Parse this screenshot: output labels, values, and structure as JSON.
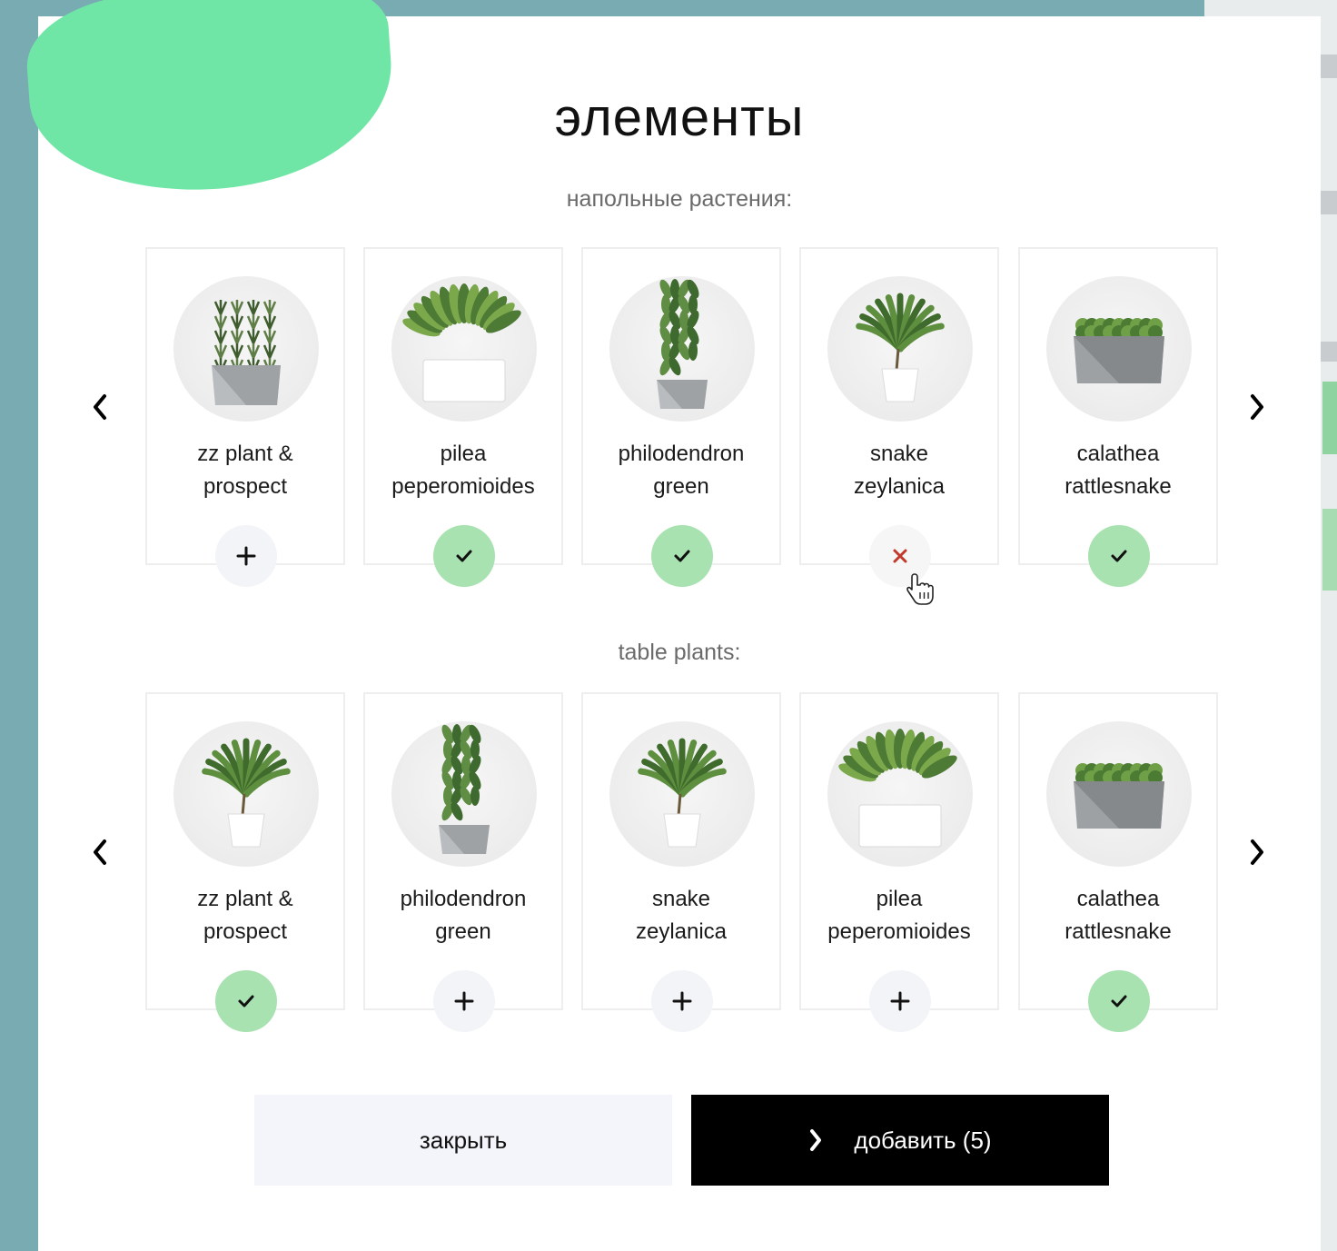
{
  "modal": {
    "title": "элементы",
    "close_label": "закрыть",
    "add_label": "добавить (5)"
  },
  "floor_section": {
    "label": "напольные растения:",
    "items": [
      {
        "line1": "zz plant &",
        "line2": "prospect",
        "state": "add",
        "plant": "grass-column"
      },
      {
        "line1": "pilea",
        "line2": "peperomioides",
        "state": "added",
        "plant": "broad-leaf"
      },
      {
        "line1": "philodendron",
        "line2": "green",
        "state": "added",
        "plant": "tall-column"
      },
      {
        "line1": "snake",
        "line2": "zeylanica",
        "state": "remove",
        "plant": "palm"
      },
      {
        "line1": "calathea",
        "line2": "rattlesnake",
        "state": "added",
        "plant": "hedge"
      }
    ]
  },
  "table_section": {
    "label": "table plants:",
    "items": [
      {
        "line1": "zz plant &",
        "line2": "prospect",
        "state": "added",
        "plant": "palm"
      },
      {
        "line1": "philodendron",
        "line2": "green",
        "state": "add",
        "plant": "tall-column"
      },
      {
        "line1": "snake",
        "line2": "zeylanica",
        "state": "add",
        "plant": "palm"
      },
      {
        "line1": "pilea",
        "line2": "peperomioides",
        "state": "add",
        "plant": "broad-leaf"
      },
      {
        "line1": "calathea",
        "line2": "rattlesnake",
        "state": "added",
        "plant": "hedge"
      }
    ]
  },
  "icons": {
    "prev": "chevron-left-icon",
    "next": "chevron-right-icon",
    "add": "plus-icon",
    "added": "check-icon",
    "remove": "cross-icon",
    "cursor": "hand-pointer-icon"
  },
  "colors": {
    "accent_green": "#a8e2b0",
    "blob_green": "#6fe6a5",
    "remove_red": "#c0392b",
    "backdrop": "#79abb3"
  }
}
